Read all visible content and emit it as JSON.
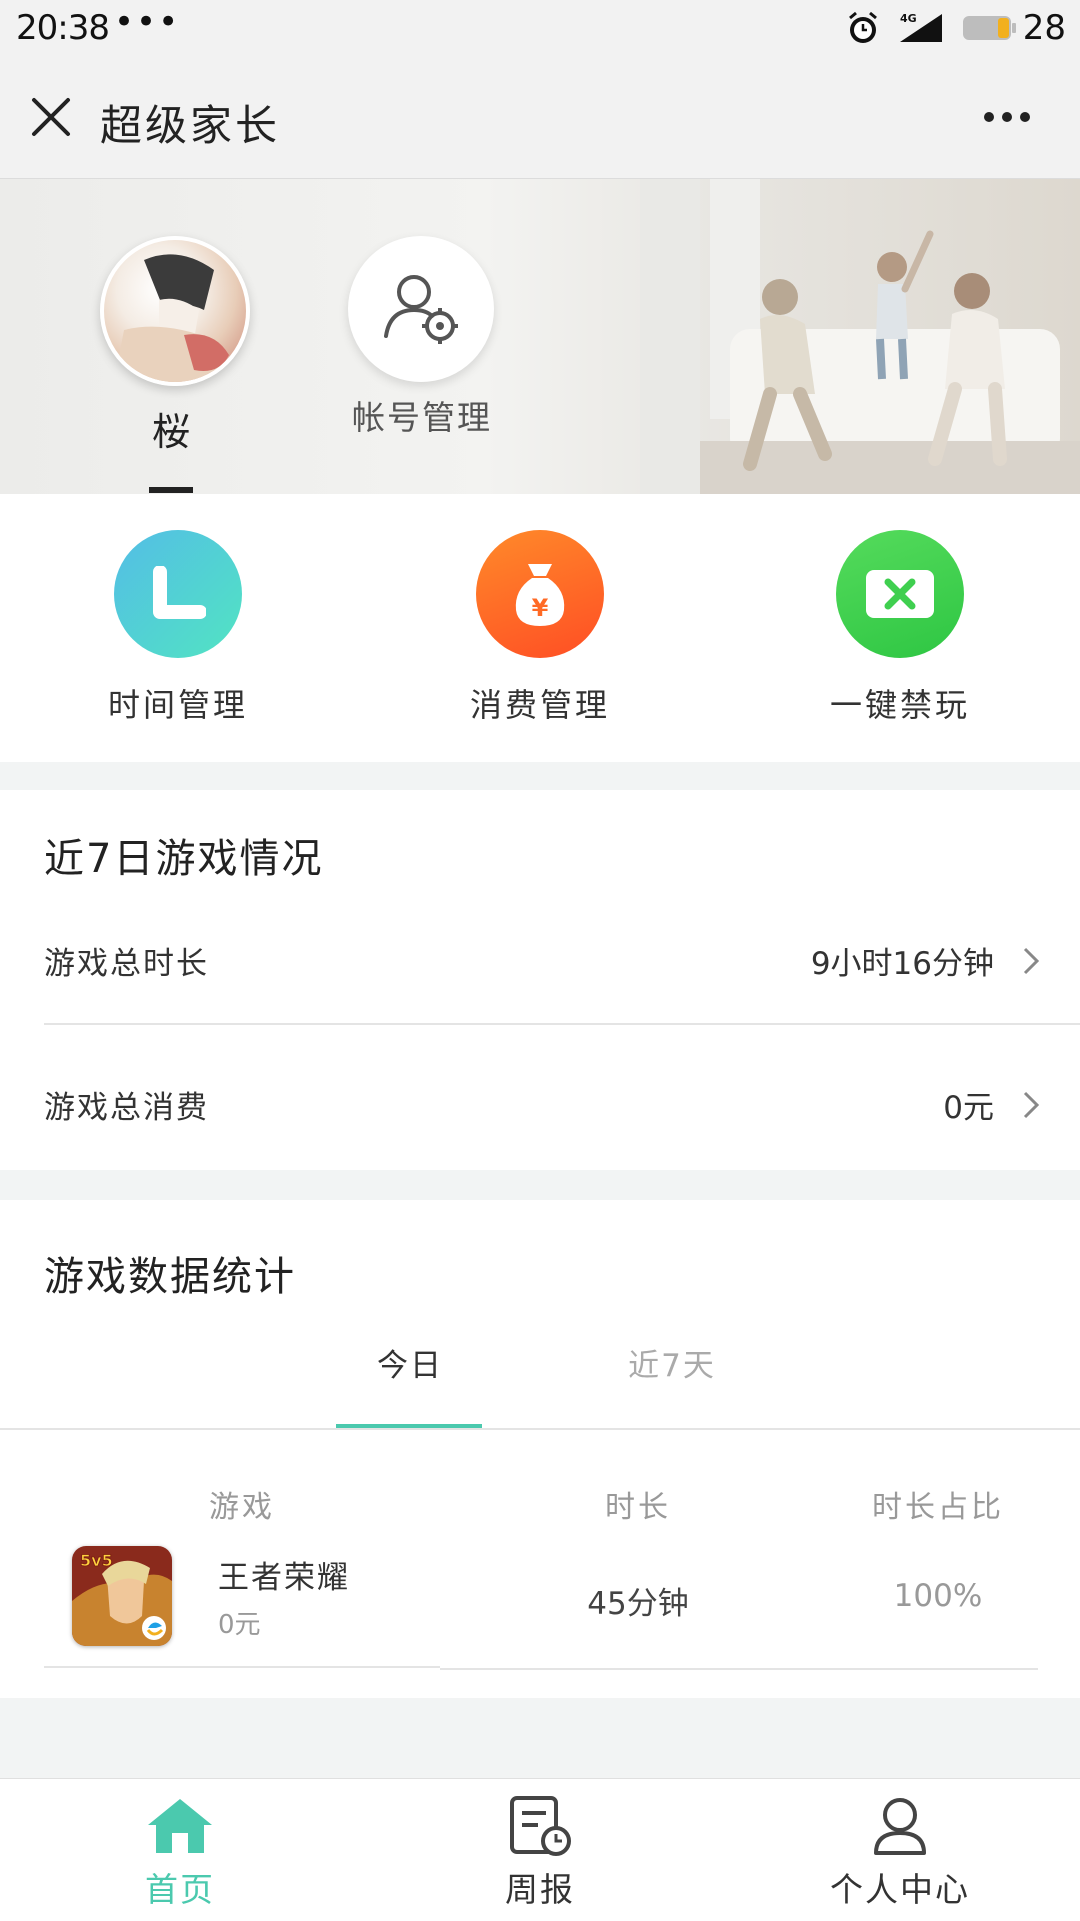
{
  "status_bar": {
    "time": "20:38",
    "dots": "•••",
    "battery": "28",
    "network": "4G"
  },
  "nav": {
    "title": "超级家长"
  },
  "profile": {
    "name": "桜",
    "account_label": "帐号管理"
  },
  "features": [
    {
      "label": "时间管理",
      "color": "#4ad3c9"
    },
    {
      "label": "消费管理",
      "color": "#ff6a25"
    },
    {
      "label": "一键禁玩",
      "color": "#3fcf4f"
    }
  ],
  "weekly": {
    "title": "近7日游戏情况",
    "rows": [
      {
        "label": "游戏总时长",
        "value": "9小时16分钟"
      },
      {
        "label": "游戏总消费",
        "value": "0元"
      }
    ]
  },
  "stats": {
    "title": "游戏数据统计",
    "tabs": [
      {
        "label": "今日",
        "active": true
      },
      {
        "label": "近7天",
        "active": false
      }
    ],
    "accent": "#4bc9ae",
    "columns": [
      "游戏",
      "时长",
      "时长占比"
    ],
    "rows": [
      {
        "game": "王者荣耀",
        "spend": "0元",
        "duration": "45分钟",
        "ratio": "100%",
        "icon_text": "5v5"
      }
    ]
  },
  "tabbar": {
    "items": [
      {
        "label": "首页",
        "active": true
      },
      {
        "label": "周报",
        "active": false
      },
      {
        "label": "个人中心",
        "active": false
      }
    ]
  }
}
